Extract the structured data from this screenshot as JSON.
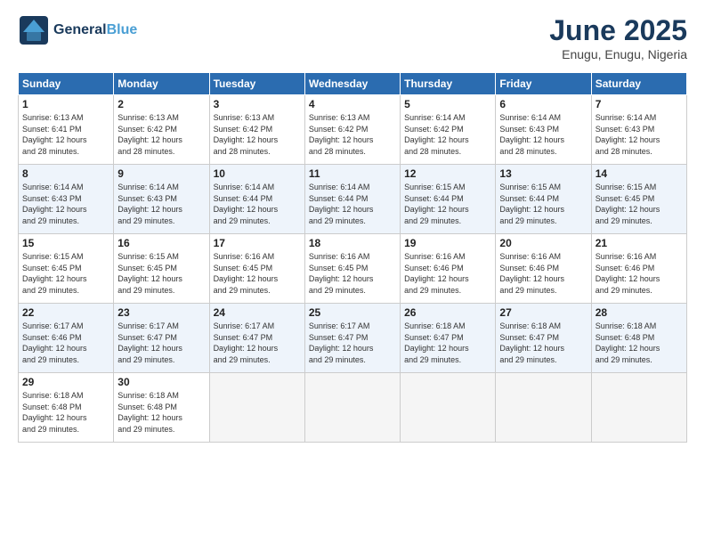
{
  "header": {
    "logo_line1": "General",
    "logo_line2": "Blue",
    "month": "June 2025",
    "location": "Enugu, Enugu, Nigeria"
  },
  "days_of_week": [
    "Sunday",
    "Monday",
    "Tuesday",
    "Wednesday",
    "Thursday",
    "Friday",
    "Saturday"
  ],
  "weeks": [
    [
      {
        "day": "1",
        "sunrise": "6:13 AM",
        "sunset": "6:41 PM",
        "daylight": "12 hours and 28 minutes."
      },
      {
        "day": "2",
        "sunrise": "6:13 AM",
        "sunset": "6:42 PM",
        "daylight": "12 hours and 28 minutes."
      },
      {
        "day": "3",
        "sunrise": "6:13 AM",
        "sunset": "6:42 PM",
        "daylight": "12 hours and 28 minutes."
      },
      {
        "day": "4",
        "sunrise": "6:13 AM",
        "sunset": "6:42 PM",
        "daylight": "12 hours and 28 minutes."
      },
      {
        "day": "5",
        "sunrise": "6:14 AM",
        "sunset": "6:42 PM",
        "daylight": "12 hours and 28 minutes."
      },
      {
        "day": "6",
        "sunrise": "6:14 AM",
        "sunset": "6:43 PM",
        "daylight": "12 hours and 28 minutes."
      },
      {
        "day": "7",
        "sunrise": "6:14 AM",
        "sunset": "6:43 PM",
        "daylight": "12 hours and 28 minutes."
      }
    ],
    [
      {
        "day": "8",
        "sunrise": "6:14 AM",
        "sunset": "6:43 PM",
        "daylight": "12 hours and 29 minutes."
      },
      {
        "day": "9",
        "sunrise": "6:14 AM",
        "sunset": "6:43 PM",
        "daylight": "12 hours and 29 minutes."
      },
      {
        "day": "10",
        "sunrise": "6:14 AM",
        "sunset": "6:44 PM",
        "daylight": "12 hours and 29 minutes."
      },
      {
        "day": "11",
        "sunrise": "6:14 AM",
        "sunset": "6:44 PM",
        "daylight": "12 hours and 29 minutes."
      },
      {
        "day": "12",
        "sunrise": "6:15 AM",
        "sunset": "6:44 PM",
        "daylight": "12 hours and 29 minutes."
      },
      {
        "day": "13",
        "sunrise": "6:15 AM",
        "sunset": "6:44 PM",
        "daylight": "12 hours and 29 minutes."
      },
      {
        "day": "14",
        "sunrise": "6:15 AM",
        "sunset": "6:45 PM",
        "daylight": "12 hours and 29 minutes."
      }
    ],
    [
      {
        "day": "15",
        "sunrise": "6:15 AM",
        "sunset": "6:45 PM",
        "daylight": "12 hours and 29 minutes."
      },
      {
        "day": "16",
        "sunrise": "6:15 AM",
        "sunset": "6:45 PM",
        "daylight": "12 hours and 29 minutes."
      },
      {
        "day": "17",
        "sunrise": "6:16 AM",
        "sunset": "6:45 PM",
        "daylight": "12 hours and 29 minutes."
      },
      {
        "day": "18",
        "sunrise": "6:16 AM",
        "sunset": "6:45 PM",
        "daylight": "12 hours and 29 minutes."
      },
      {
        "day": "19",
        "sunrise": "6:16 AM",
        "sunset": "6:46 PM",
        "daylight": "12 hours and 29 minutes."
      },
      {
        "day": "20",
        "sunrise": "6:16 AM",
        "sunset": "6:46 PM",
        "daylight": "12 hours and 29 minutes."
      },
      {
        "day": "21",
        "sunrise": "6:16 AM",
        "sunset": "6:46 PM",
        "daylight": "12 hours and 29 minutes."
      }
    ],
    [
      {
        "day": "22",
        "sunrise": "6:17 AM",
        "sunset": "6:46 PM",
        "daylight": "12 hours and 29 minutes."
      },
      {
        "day": "23",
        "sunrise": "6:17 AM",
        "sunset": "6:47 PM",
        "daylight": "12 hours and 29 minutes."
      },
      {
        "day": "24",
        "sunrise": "6:17 AM",
        "sunset": "6:47 PM",
        "daylight": "12 hours and 29 minutes."
      },
      {
        "day": "25",
        "sunrise": "6:17 AM",
        "sunset": "6:47 PM",
        "daylight": "12 hours and 29 minutes."
      },
      {
        "day": "26",
        "sunrise": "6:18 AM",
        "sunset": "6:47 PM",
        "daylight": "12 hours and 29 minutes."
      },
      {
        "day": "27",
        "sunrise": "6:18 AM",
        "sunset": "6:47 PM",
        "daylight": "12 hours and 29 minutes."
      },
      {
        "day": "28",
        "sunrise": "6:18 AM",
        "sunset": "6:48 PM",
        "daylight": "12 hours and 29 minutes."
      }
    ],
    [
      {
        "day": "29",
        "sunrise": "6:18 AM",
        "sunset": "6:48 PM",
        "daylight": "12 hours and 29 minutes."
      },
      {
        "day": "30",
        "sunrise": "6:18 AM",
        "sunset": "6:48 PM",
        "daylight": "12 hours and 29 minutes."
      },
      null,
      null,
      null,
      null,
      null
    ]
  ],
  "labels": {
    "sunrise": "Sunrise:",
    "sunset": "Sunset:",
    "daylight": "Daylight:"
  }
}
